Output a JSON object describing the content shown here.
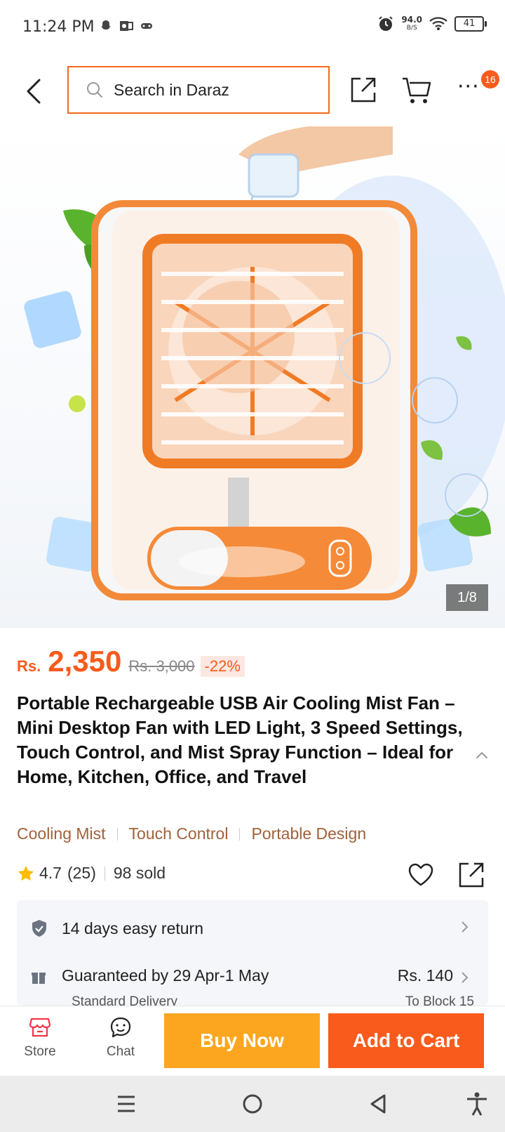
{
  "status_bar": {
    "time": "11:24 PM",
    "net_speed": "94.0",
    "net_speed_unit": "B/S",
    "battery": "41"
  },
  "header": {
    "search_placeholder": "Search in Daraz",
    "cart_badge": "16"
  },
  "gallery": {
    "counter": "1/8"
  },
  "product": {
    "currency": "Rs.",
    "price": "2,350",
    "original_price": "Rs. 3,000",
    "discount": "-22%",
    "title": "Portable Rechargeable USB Air Cooling Mist Fan – Mini Desktop Fan with LED Light, 3 Speed Settings, Touch Control, and Mist Spray Function – Ideal for Home, Kitchen, Office, and Travel",
    "tags": [
      "Cooling Mist",
      "Touch Control",
      "Portable Design"
    ],
    "rating": "4.7",
    "rating_count": "(25)",
    "sold": "98 sold"
  },
  "info": {
    "return_text": "14 days easy return",
    "delivery_text": "Guaranteed by 29 Apr-1 May",
    "delivery_fee": "Rs. 140",
    "delivery_type": "Standard Delivery",
    "delivery_location": "To Block 15"
  },
  "actions": {
    "store_label": "Store",
    "chat_label": "Chat",
    "buy_now_label": "Buy Now",
    "add_to_cart_label": "Add to Cart"
  },
  "colors": {
    "brand_orange": "#f85b1b",
    "buy_now_yellow": "#fca61f",
    "tag_brown": "#a0613a"
  }
}
